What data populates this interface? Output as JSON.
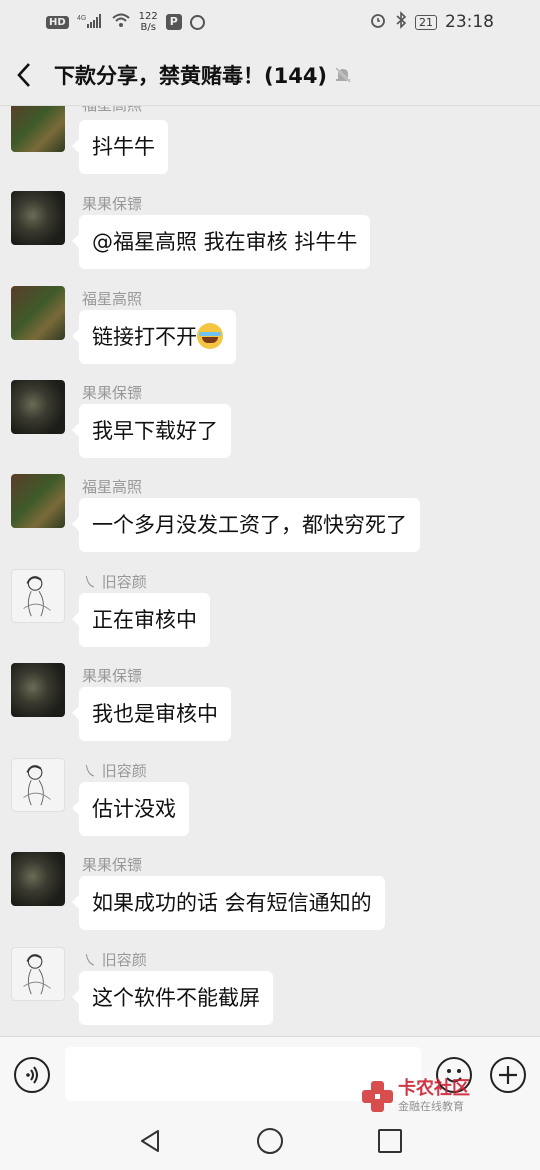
{
  "status_bar": {
    "hd": "HD",
    "net": "4G",
    "speed_value": "122",
    "speed_unit": "B/s",
    "battery": "21",
    "time": "23:18"
  },
  "header": {
    "title": "下款分享，禁黄赌毒！(144)"
  },
  "messages": [
    {
      "sender": "福星高照",
      "text": "抖牛牛",
      "avatar": "fu"
    },
    {
      "sender": "果果保镖",
      "text": "@福星高照  我在审核  抖牛牛",
      "avatar": "guo"
    },
    {
      "sender": "福星高照",
      "text": "链接打不开",
      "avatar": "fu",
      "emoji": "crying-laughing-emoji"
    },
    {
      "sender": "果果保镖",
      "text": "我早下载好了",
      "avatar": "guo"
    },
    {
      "sender": "福星高照",
      "text": "一个多月没发工资了，都快穷死了",
      "avatar": "fu"
    },
    {
      "sender": "㇏ 旧容颜",
      "text": "正在审核中",
      "avatar": "jiu"
    },
    {
      "sender": "果果保镖",
      "text": "我也是审核中",
      "avatar": "guo"
    },
    {
      "sender": "㇏ 旧容颜",
      "text": "估计没戏",
      "avatar": "jiu"
    },
    {
      "sender": "果果保镖",
      "text": "如果成功的话  会有短信通知的",
      "avatar": "guo"
    },
    {
      "sender": "㇏ 旧容颜",
      "text": "这个软件不能截屏",
      "avatar": "jiu"
    }
  ],
  "input_bar": {
    "voice_icon": "voice-icon",
    "emoji_icon": "smiley-icon",
    "plus_icon": "plus-icon"
  },
  "watermark": {
    "name": "卡农社区",
    "tagline": "金融在线教育"
  }
}
